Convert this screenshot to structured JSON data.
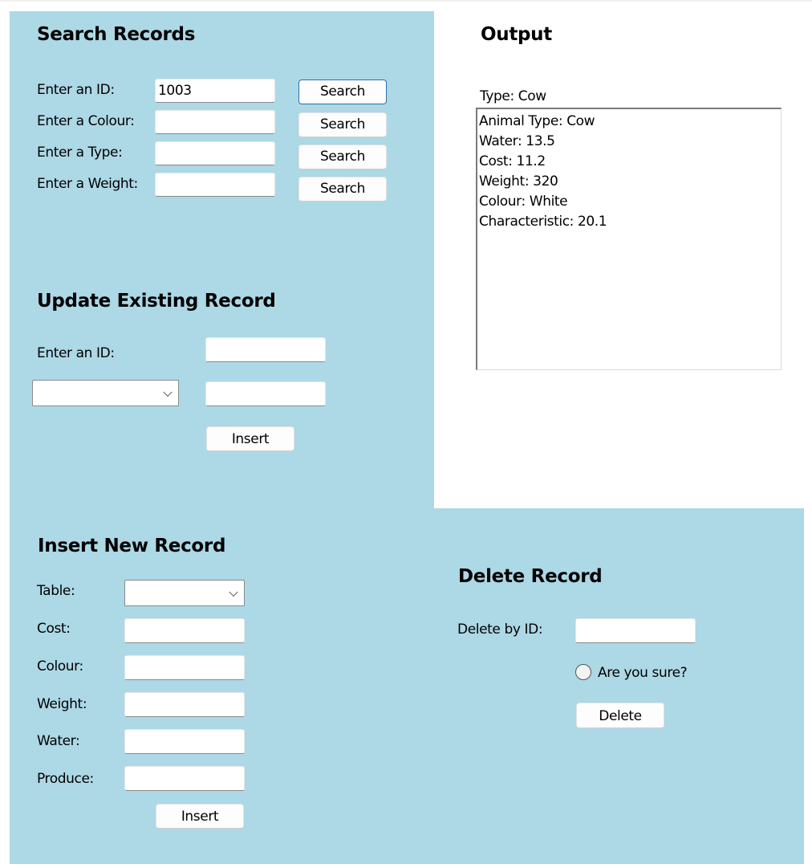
{
  "search": {
    "title": "Search Records",
    "rows": [
      {
        "label": "Enter an ID:",
        "value": "1003",
        "button": "Search"
      },
      {
        "label": "Enter a Colour:",
        "value": "",
        "button": "Search"
      },
      {
        "label": "Enter a Type:",
        "value": "",
        "button": "Search"
      },
      {
        "label": "Enter a Weight:",
        "value": "",
        "button": "Search"
      }
    ]
  },
  "output": {
    "title": "Output",
    "type_label": "Type: Cow",
    "lines": [
      "Animal Type: Cow",
      "Water: 13.5",
      "Cost: 11.2",
      "Weight: 320",
      "Colour: White",
      "Characteristic: 20.1"
    ]
  },
  "update": {
    "title": "Update Existing Record",
    "id_label": "Enter an ID:",
    "id_value": "",
    "field_select": "",
    "new_value": "",
    "button": "Insert"
  },
  "insert": {
    "title": "Insert New Record",
    "table_label": "Table:",
    "table_value": "",
    "fields": [
      {
        "label": "Cost:",
        "value": ""
      },
      {
        "label": "Colour:",
        "value": ""
      },
      {
        "label": "Weight:",
        "value": ""
      },
      {
        "label": "Water:",
        "value": ""
      },
      {
        "label": "Produce:",
        "value": ""
      }
    ],
    "button": "Insert"
  },
  "delete": {
    "title": "Delete Record",
    "id_label": "Delete by ID:",
    "id_value": "",
    "confirm_label": "Are you sure?",
    "confirm_checked": false,
    "button": "Delete"
  },
  "colors": {
    "panel": "#add8e6",
    "focus_border": "#2f6fb0"
  }
}
